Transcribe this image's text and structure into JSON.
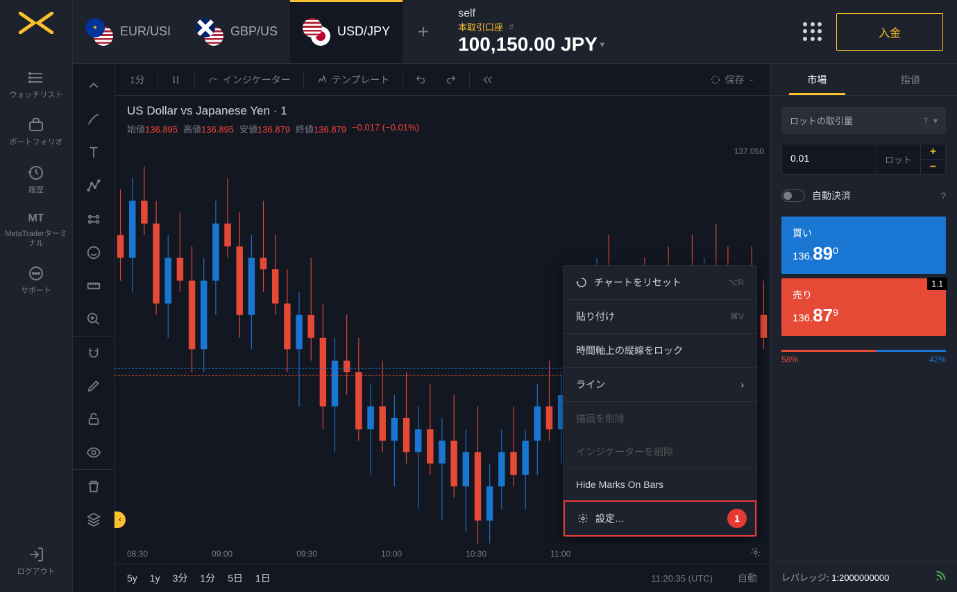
{
  "sidebar": {
    "watchlist": "ウォッチリスト",
    "portfolio": "ポートフォリオ",
    "history": "履歴",
    "mt": "MT",
    "mt_sub": "MetaTraderターミナル",
    "support": "サポート",
    "logout": "ログアウト"
  },
  "tabs": [
    {
      "label": "EUR/USI"
    },
    {
      "label": "GBP/US"
    },
    {
      "label": "USD/JPY",
      "active": true
    }
  ],
  "account": {
    "label": "本取引口座",
    "hash": "#",
    "balance": "100,150.00 JPY"
  },
  "deposit": "入金",
  "chart_toolbar": {
    "timeframe": "1分",
    "indicator": "インジケーター",
    "template": "テンプレート",
    "save": "保存"
  },
  "chart_header": {
    "title": "US Dollar vs Japanese Yen · 1",
    "open_label": "始値",
    "open": "136.895",
    "high_label": "高値",
    "high": "136.895",
    "low_label": "安値",
    "low": "136.879",
    "close_label": "終値",
    "close": "136.879",
    "change": "−0.017 (−0.01%)"
  },
  "y_axis": {
    "top": "137.050"
  },
  "x_axis": [
    "08:30",
    "09:00",
    "09:30",
    "10:00",
    "10:30",
    "11:00"
  ],
  "timeframes": [
    "5y",
    "1y",
    "3分",
    "1分",
    "5日",
    "1日"
  ],
  "clock": "11:20:35 (UTC)",
  "auto_label": "自動",
  "context_menu": {
    "reset": "チャートをリセット",
    "reset_key": "⌥R",
    "paste": "貼り付け",
    "paste_key": "⌘V",
    "lock_vlines": "時間軸上の縦線をロック",
    "line": "ライン",
    "remove_drawings": "描画を削除",
    "remove_indicators": "インジケーターを削除",
    "hide_marks": "Hide Marks On Bars",
    "settings": "設定…",
    "badge": "1"
  },
  "panel": {
    "tab_market": "市場",
    "tab_limit": "指値",
    "lot_title": "ロットの取引量",
    "lot_value": "0.01",
    "lot_label": "ロット",
    "auto_settle": "自動決済",
    "buy_label": "買い",
    "buy_price_pre": "136.",
    "buy_price_big": "89",
    "buy_price_sup": "0",
    "sell_label": "売り",
    "sell_price_pre": "136.",
    "sell_price_big": "87",
    "sell_price_sup": "9",
    "spread": "1.1",
    "sentiment_buy": "58%",
    "sentiment_sell": "42%",
    "leverage_label": "レバレッジ:",
    "leverage_value": "1:2000000000"
  },
  "chart_data": {
    "type": "candlestick",
    "title": "US Dollar vs Japanese Yen · 1",
    "ylim": [
      136.7,
      137.05
    ],
    "x_ticks": [
      "08:30",
      "09:00",
      "09:30",
      "10:00",
      "10:30",
      "11:00"
    ],
    "reference_lines": [
      {
        "y": 136.89,
        "color": "#1976d2",
        "style": "dashed"
      },
      {
        "y": 136.879,
        "color": "#e64a36",
        "style": "dashed"
      }
    ],
    "candles": [
      {
        "o": 136.97,
        "h": 137.01,
        "l": 136.93,
        "c": 136.95
      },
      {
        "o": 136.95,
        "h": 137.02,
        "l": 136.92,
        "c": 137.0
      },
      {
        "o": 137.0,
        "h": 137.03,
        "l": 136.97,
        "c": 136.98
      },
      {
        "o": 136.98,
        "h": 137.0,
        "l": 136.9,
        "c": 136.91
      },
      {
        "o": 136.91,
        "h": 136.97,
        "l": 136.88,
        "c": 136.95
      },
      {
        "o": 136.95,
        "h": 136.99,
        "l": 136.92,
        "c": 136.93
      },
      {
        "o": 136.93,
        "h": 136.96,
        "l": 136.85,
        "c": 136.87
      },
      {
        "o": 136.87,
        "h": 136.95,
        "l": 136.85,
        "c": 136.93
      },
      {
        "o": 136.93,
        "h": 137.0,
        "l": 136.9,
        "c": 136.98
      },
      {
        "o": 136.98,
        "h": 137.02,
        "l": 136.95,
        "c": 136.96
      },
      {
        "o": 136.96,
        "h": 136.99,
        "l": 136.88,
        "c": 136.9
      },
      {
        "o": 136.9,
        "h": 136.97,
        "l": 136.87,
        "c": 136.95
      },
      {
        "o": 136.95,
        "h": 137.0,
        "l": 136.92,
        "c": 136.94
      },
      {
        "o": 136.94,
        "h": 136.97,
        "l": 136.9,
        "c": 136.91
      },
      {
        "o": 136.91,
        "h": 136.94,
        "l": 136.85,
        "c": 136.87
      },
      {
        "o": 136.87,
        "h": 136.92,
        "l": 136.82,
        "c": 136.9
      },
      {
        "o": 136.9,
        "h": 136.95,
        "l": 136.86,
        "c": 136.88
      },
      {
        "o": 136.88,
        "h": 136.91,
        "l": 136.8,
        "c": 136.82
      },
      {
        "o": 136.82,
        "h": 136.88,
        "l": 136.78,
        "c": 136.86
      },
      {
        "o": 136.86,
        "h": 136.9,
        "l": 136.83,
        "c": 136.85
      },
      {
        "o": 136.85,
        "h": 136.88,
        "l": 136.79,
        "c": 136.8
      },
      {
        "o": 136.8,
        "h": 136.84,
        "l": 136.76,
        "c": 136.82
      },
      {
        "o": 136.82,
        "h": 136.86,
        "l": 136.78,
        "c": 136.79
      },
      {
        "o": 136.79,
        "h": 136.83,
        "l": 136.75,
        "c": 136.81
      },
      {
        "o": 136.81,
        "h": 136.85,
        "l": 136.77,
        "c": 136.78
      },
      {
        "o": 136.78,
        "h": 136.82,
        "l": 136.73,
        "c": 136.8
      },
      {
        "o": 136.8,
        "h": 136.84,
        "l": 136.76,
        "c": 136.77
      },
      {
        "o": 136.77,
        "h": 136.81,
        "l": 136.72,
        "c": 136.79
      },
      {
        "o": 136.79,
        "h": 136.83,
        "l": 136.74,
        "c": 136.75
      },
      {
        "o": 136.75,
        "h": 136.8,
        "l": 136.71,
        "c": 136.78
      },
      {
        "o": 136.78,
        "h": 136.82,
        "l": 136.7,
        "c": 136.72
      },
      {
        "o": 136.72,
        "h": 136.77,
        "l": 136.7,
        "c": 136.75
      },
      {
        "o": 136.75,
        "h": 136.8,
        "l": 136.73,
        "c": 136.78
      },
      {
        "o": 136.78,
        "h": 136.82,
        "l": 136.75,
        "c": 136.76
      },
      {
        "o": 136.76,
        "h": 136.8,
        "l": 136.73,
        "c": 136.79
      },
      {
        "o": 136.79,
        "h": 136.84,
        "l": 136.76,
        "c": 136.82
      },
      {
        "o": 136.82,
        "h": 136.86,
        "l": 136.79,
        "c": 136.8
      },
      {
        "o": 136.8,
        "h": 136.85,
        "l": 136.77,
        "c": 136.83
      },
      {
        "o": 136.83,
        "h": 136.88,
        "l": 136.8,
        "c": 136.86
      },
      {
        "o": 136.86,
        "h": 136.92,
        "l": 136.83,
        "c": 136.9
      },
      {
        "o": 136.9,
        "h": 136.95,
        "l": 136.87,
        "c": 136.93
      },
      {
        "o": 136.93,
        "h": 136.97,
        "l": 136.89,
        "c": 136.91
      },
      {
        "o": 136.91,
        "h": 136.94,
        "l": 136.86,
        "c": 136.88
      },
      {
        "o": 136.88,
        "h": 136.93,
        "l": 136.85,
        "c": 136.91
      },
      {
        "o": 136.91,
        "h": 136.95,
        "l": 136.88,
        "c": 136.89
      },
      {
        "o": 136.89,
        "h": 136.93,
        "l": 136.86,
        "c": 136.92
      },
      {
        "o": 136.92,
        "h": 136.96,
        "l": 136.89,
        "c": 136.9
      },
      {
        "o": 136.9,
        "h": 136.94,
        "l": 136.86,
        "c": 136.93
      },
      {
        "o": 136.93,
        "h": 136.97,
        "l": 136.9,
        "c": 136.91
      },
      {
        "o": 136.91,
        "h": 136.95,
        "l": 136.88,
        "c": 136.94
      },
      {
        "o": 136.94,
        "h": 136.98,
        "l": 136.91,
        "c": 136.92
      },
      {
        "o": 136.92,
        "h": 136.96,
        "l": 136.88,
        "c": 136.9
      },
      {
        "o": 136.9,
        "h": 136.94,
        "l": 136.87,
        "c": 136.93
      },
      {
        "o": 136.93,
        "h": 136.96,
        "l": 136.89,
        "c": 136.9
      },
      {
        "o": 136.9,
        "h": 136.93,
        "l": 136.87,
        "c": 136.88
      }
    ]
  }
}
